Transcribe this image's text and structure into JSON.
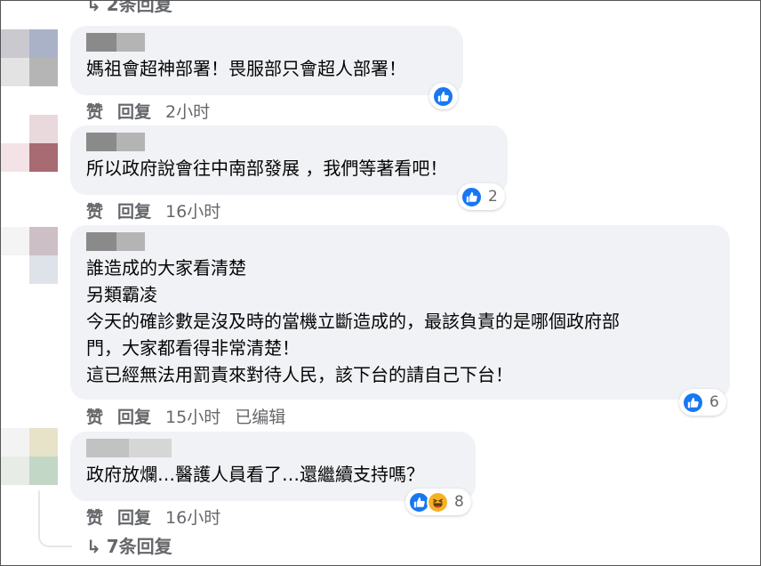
{
  "top_replies": {
    "arrow": "↳",
    "label": "2条回复"
  },
  "comments": [
    {
      "text": "媽祖會超神部署！畏服部只會超人部署！",
      "like_label": "赞",
      "reply_label": "回复",
      "time": "2小时",
      "reaction_count": ""
    },
    {
      "text": "所以政府說會往中南部發展 ，我們等著看吧！",
      "like_label": "赞",
      "reply_label": "回复",
      "time": "16小时",
      "reaction_count": "2"
    },
    {
      "text": "誰造成的大家看清楚\n另類霸凌\n今天的確診數是沒及時的當機立斷造成的，最該負責的是哪個政府部\n門，大家都看得非常清楚！\n這已經無法用罰責來對待人民，該下台的請自己下台！",
      "like_label": "赞",
      "reply_label": "回复",
      "time": "15小时",
      "edited": "已编辑",
      "reaction_count": "6"
    },
    {
      "text": "政府放爛…醫護人員看了…還繼續支持嗎？",
      "like_label": "赞",
      "reply_label": "回复",
      "time": "16小时",
      "reaction_count": "8"
    }
  ],
  "more_replies": {
    "arrow": "↳",
    "label": "7条回复"
  },
  "icons": {
    "like": "like-icon",
    "haha": "haha-icon"
  },
  "colors": {
    "like_blue": "#1877f2",
    "bubble": "#f0f2f5",
    "meta": "#65676b"
  }
}
